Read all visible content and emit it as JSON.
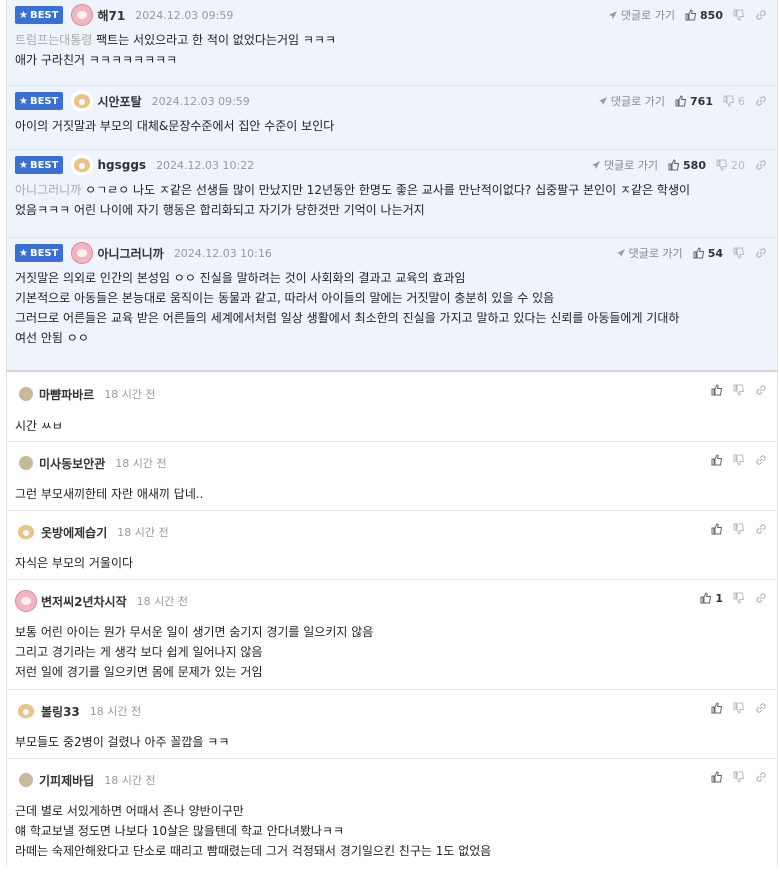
{
  "best_label": "BEST",
  "reply_label": "댓글로 가기",
  "best_comments": [
    {
      "nick": "해71",
      "date": "2024.12.03 09:59",
      "likes": "850",
      "dislikes": "",
      "avatar": "pink",
      "ref": "트럼프는대통령",
      "lines": [
        "팩트는 서있으라고 한 적이 없었다는거임 ㅋㅋㅋ",
        "애가 구라친거 ㅋㅋㅋㅋㅋㅋㅋㅋ"
      ]
    },
    {
      "nick": "시안포탈",
      "date": "2024.12.03 09:59",
      "likes": "761",
      "dislikes": "6",
      "avatar": "fox",
      "ref": "",
      "lines": [
        "아이의 거짓말과 부모의 대체&문장수준에서 집안 수준이 보인다"
      ]
    },
    {
      "nick": "hgsggs",
      "date": "2024.12.03 10:22",
      "likes": "580",
      "dislikes": "20",
      "avatar": "fox",
      "ref": "아니그러니까",
      "lines": [
        "ㅇㄱㄹㅇ 나도 ㅈ같은 선생들 많이 만났지만 12년동안 한명도 좋은 교사를 만난적이없다? 십중팔구 본인이 ㅈ같은 학생이",
        "었음ㅋㅋㅋ 어린 나이에 자기 행동은 합리화되고 자기가 당한것만 기억이 나는거지"
      ]
    },
    {
      "nick": "아니그러니까",
      "date": "2024.12.03 10:16",
      "likes": "54",
      "dislikes": "",
      "avatar": "pink",
      "ref": "",
      "lines": [
        "거짓말은 의외로 인간의 본성임 ㅇㅇ 진실을 말하려는 것이 사회화의 결과고 교육의 효과임",
        "기본적으로 아동들은 본능대로 움직이는 동물과 같고, 따라서 아이들의 말에는 거짓말이 충분히 있을 수 있음",
        "그러므로 어른들은 교육 받은 어른들의 세계에서처럼 일상 생활에서 최소한의 진실을 가지고 말하고 있다는 신뢰를 아동들에게 기대하",
        "여선 안됨 ㅇㅇ"
      ]
    }
  ],
  "comments": [
    {
      "nick": "마뺨파바르",
      "date": "18 시간 전",
      "likes": "",
      "avatar": "dot",
      "lines": [
        "시간 ㅆㅂ"
      ]
    },
    {
      "nick": "미사동보안관",
      "date": "18 시간 전",
      "likes": "",
      "avatar": "dot",
      "lines": [
        "그런 부모새끼한테 자란 애새끼 답네.."
      ]
    },
    {
      "nick": "옷방에제습기",
      "date": "18 시간 전",
      "likes": "",
      "avatar": "fox",
      "lines": [
        "자식은 부모의 거울이다"
      ]
    },
    {
      "nick": "변저씨2년차시작",
      "date": "18 시간 전",
      "likes": "1",
      "avatar": "pink",
      "lines": [
        "보통 어린 아이는 뭔가 무서운 일이 생기면 숨기지 경기를 일으키지 않음",
        "그리고 경기라는 게 생각 보다 쉽게 일어나지 않음",
        "저런 일에 경기를 일으키면 몸에 문제가 있는 거임"
      ]
    },
    {
      "nick": "볼링33",
      "date": "18 시간 전",
      "likes": "",
      "avatar": "fox",
      "lines": [
        "부모들도 중2병이 걸렸나 아주 꼴깝을 ㅋㅋ"
      ]
    },
    {
      "nick": "기피제바딥",
      "date": "18 시간 전",
      "likes": "",
      "avatar": "dot",
      "lines": [
        "근데 별로 서있게하면 어때서 존나 양반이구만",
        "얘 학교보낼 정도면 나보다 10살은 많을텐데 학교 안다녀봤나ㅋㅋ",
        "라떼는 숙제안해왔다고 단소로 때리고 빰때렸는데 그거 걱정돼서 경기일으킨 친구는 1도 없었음"
      ]
    }
  ]
}
